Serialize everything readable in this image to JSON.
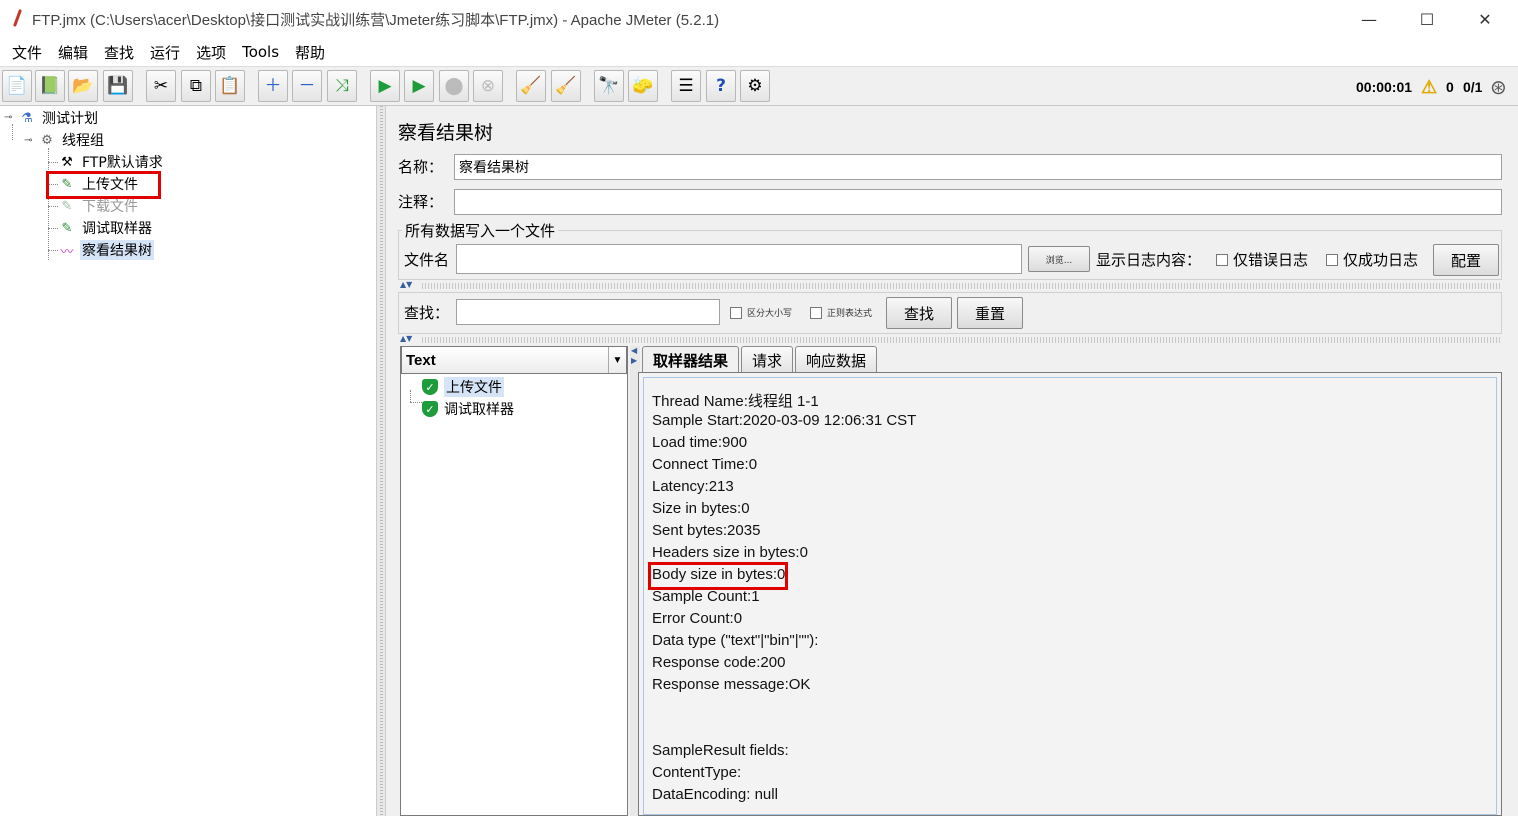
{
  "window": {
    "title": "FTP.jmx (C:\\Users\\acer\\Desktop\\接口测试实战训练营\\Jmeter练习脚本\\FTP.jmx) - Apache JMeter (5.2.1)",
    "minimize_glyph": "—",
    "maximize_glyph": "☐",
    "close_glyph": "✕"
  },
  "menu": [
    "文件",
    "编辑",
    "查找",
    "运行",
    "选项",
    "Tools",
    "帮助"
  ],
  "toolbar": {
    "icons": [
      "new-icon",
      "templates-icon",
      "open-icon",
      "save-icon",
      "cut-icon",
      "copy-icon",
      "paste-icon",
      "expand-icon",
      "collapse-icon",
      "toggle-icon",
      "start-icon",
      "start-no-pauses-icon",
      "stop-icon",
      "shutdown-icon",
      "clear-icon",
      "clear-all-icon",
      "search-icon",
      "reset-search-icon",
      "function-helper-icon",
      "help-icon",
      "remote-icon"
    ],
    "elapsed": "00:00:01",
    "warnings": "0",
    "threads": "0/1"
  },
  "tree": {
    "nodes": [
      {
        "label": "测试计划",
        "icon": "flask-icon"
      },
      {
        "label": "线程组",
        "icon": "gear-icon"
      },
      {
        "label": "FTP默认请求",
        "icon": "wrench-icon"
      },
      {
        "label": "上传文件",
        "icon": "pipette-icon"
      },
      {
        "label": "下载文件",
        "icon": "pipette-icon"
      },
      {
        "label": "调试取样器",
        "icon": "pipette-icon"
      },
      {
        "label": "察看结果树",
        "icon": "graph-icon"
      }
    ]
  },
  "panel": {
    "title": "察看结果树",
    "name_label": "名称：",
    "name_value": "察看结果树",
    "comment_label": "注释：",
    "comment_value": "",
    "file_group_title": "所有数据写入一个文件",
    "filename_label": "文件名",
    "filename_value": "",
    "browse_label": "浏览...",
    "log_display_label": "显示日志内容：",
    "errors_only_label": "仅错误日志",
    "success_only_label": "仅成功日志",
    "configure_label": "配置",
    "search_label": "查找：",
    "search_value": "",
    "case_sensitive_label": "区分大小写",
    "regex_label": "正则表达式",
    "search_button": "查找",
    "reset_button": "重置"
  },
  "results": {
    "renderer": "Text",
    "items": [
      {
        "label": "上传文件",
        "status": "success"
      },
      {
        "label": "调试取样器",
        "status": "success"
      }
    ],
    "tabs": [
      "取样器结果",
      "请求",
      "响应数据"
    ],
    "lines": [
      "Thread Name:线程组 1-1",
      "Sample Start:2020-03-09 12:06:31 CST",
      "Load time:900",
      "Connect Time:0",
      "Latency:213",
      "Size in bytes:0",
      "Sent bytes:2035",
      "Headers size in bytes:0",
      "Body size in bytes:0",
      "Sample Count:1",
      "Error Count:0",
      "Data type (\"text\"|\"bin\"|\"\"):",
      "Response code:200",
      "Response message:OK",
      "",
      "",
      "SampleResult fields:",
      "ContentType:",
      "DataEncoding: null"
    ]
  },
  "colors": {
    "highlight": "#e00000",
    "selection": "#d6e4f7",
    "success": "#1e9b3a"
  }
}
